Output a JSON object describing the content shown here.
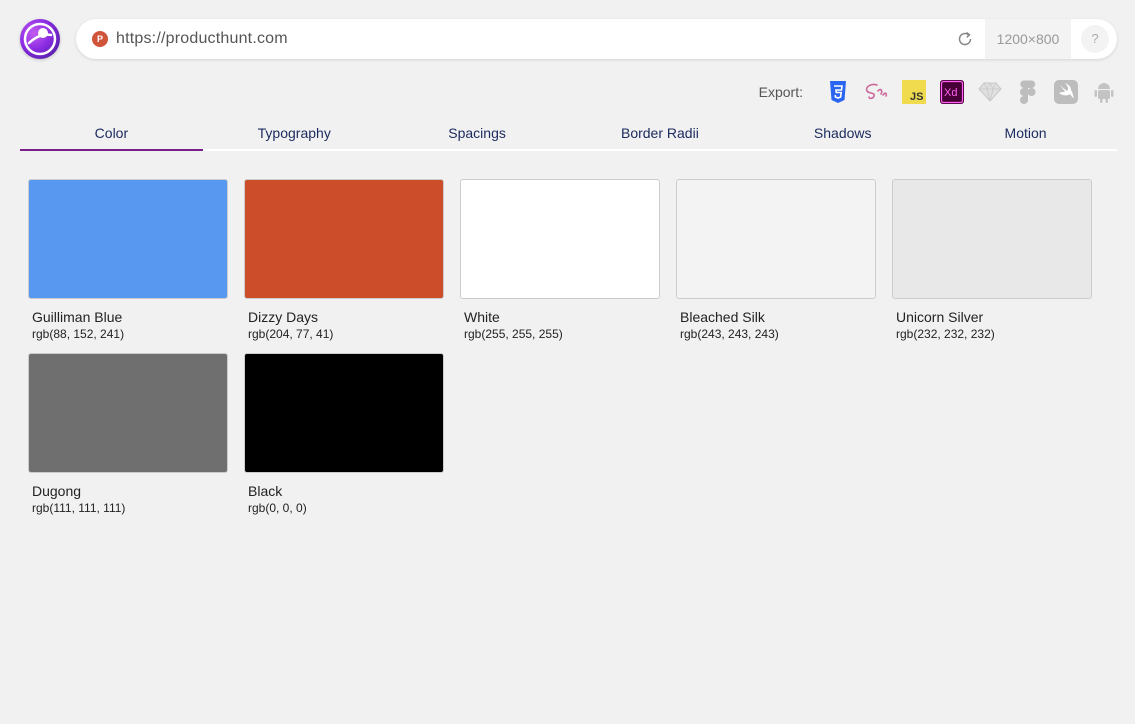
{
  "browser": {
    "url": "https://producthunt.com",
    "favicon_letter": "P",
    "dimensions": "1200×800",
    "help": "?"
  },
  "export": {
    "label": "Export:",
    "formats": [
      "css3-icon",
      "sass-icon",
      "js-icon",
      "xd-icon",
      "sketch-icon",
      "figma-icon",
      "swift-icon",
      "android-icon"
    ]
  },
  "tabs": [
    {
      "label": "Color",
      "active": true
    },
    {
      "label": "Typography"
    },
    {
      "label": "Spacings"
    },
    {
      "label": "Border Radii"
    },
    {
      "label": "Shadows"
    },
    {
      "label": "Motion"
    }
  ],
  "colors": [
    {
      "name": "Guilliman Blue",
      "rgb": "rgb(88, 152, 241)",
      "hex": "#5898f1"
    },
    {
      "name": "Dizzy Days",
      "rgb": "rgb(204, 77, 41)",
      "hex": "#cc4d29"
    },
    {
      "name": "White",
      "rgb": "rgb(255, 255, 255)",
      "hex": "#ffffff"
    },
    {
      "name": "Bleached Silk",
      "rgb": "rgb(243, 243, 243)",
      "hex": "#f3f3f3"
    },
    {
      "name": "Unicorn Silver",
      "rgb": "rgb(232, 232, 232)",
      "hex": "#e8e8e8"
    },
    {
      "name": "Dugong",
      "rgb": "rgb(111, 111, 111)",
      "hex": "#6f6f6f"
    },
    {
      "name": "Black",
      "rgb": "rgb(0, 0, 0)",
      "hex": "#000000"
    }
  ]
}
